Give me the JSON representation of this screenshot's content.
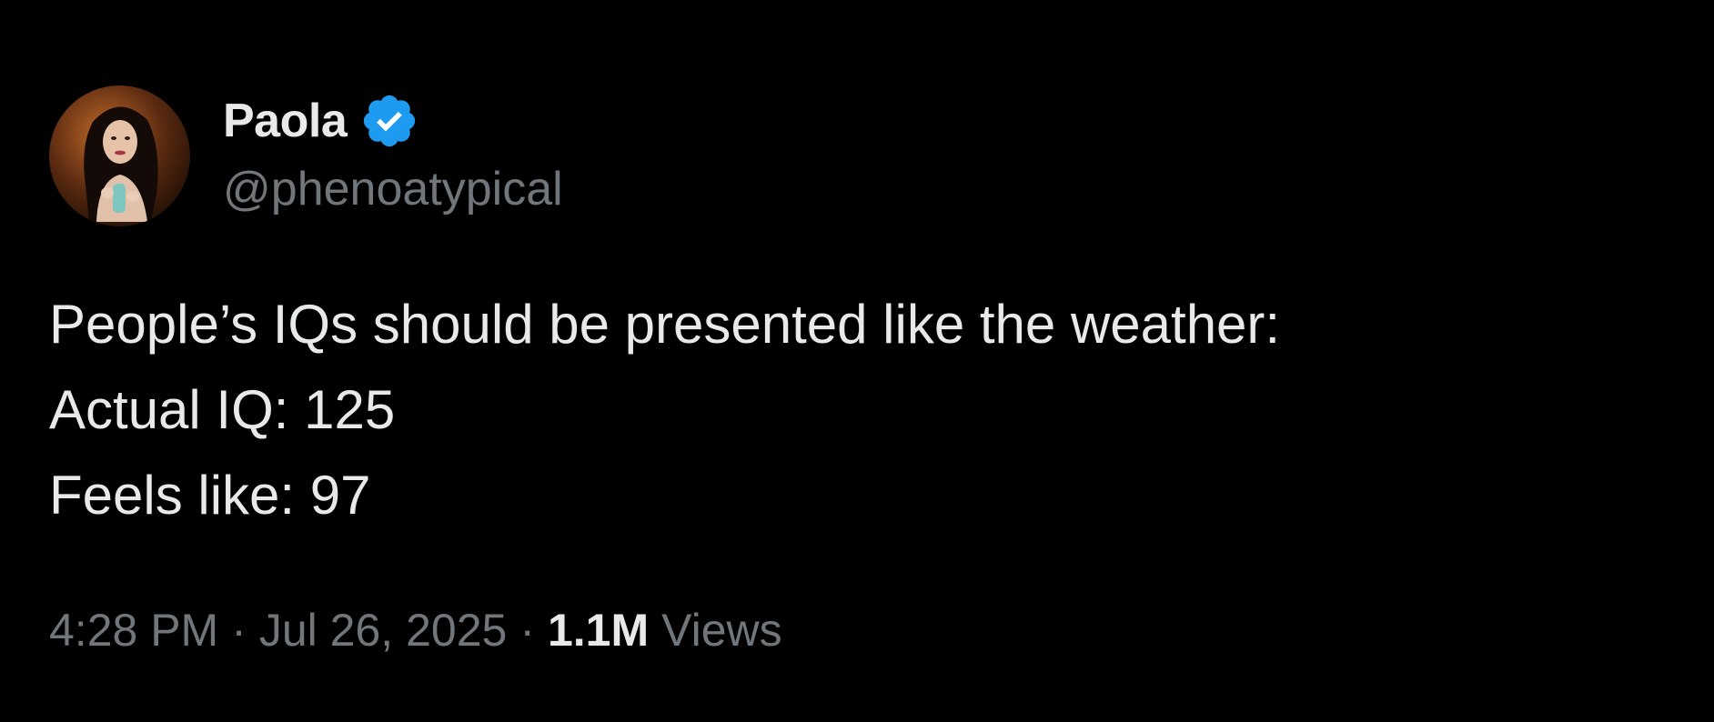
{
  "author": {
    "display_name": "Paola",
    "handle": "@phenoatypical",
    "verified": true,
    "avatar_icon": "profile-photo",
    "verified_color": "#1d9bf0"
  },
  "tweet": {
    "lines": [
      "People’s IQs should be presented like the weather:",
      "Actual IQ: 125",
      "Feels like: 97"
    ]
  },
  "meta": {
    "time": "4:28 PM",
    "separator": "·",
    "date": "Jul 26, 2025",
    "views_count": "1.1M",
    "views_label": "Views"
  },
  "colors": {
    "background": "#000000",
    "text_primary": "#e7e9ea",
    "text_secondary": "#71767b"
  }
}
